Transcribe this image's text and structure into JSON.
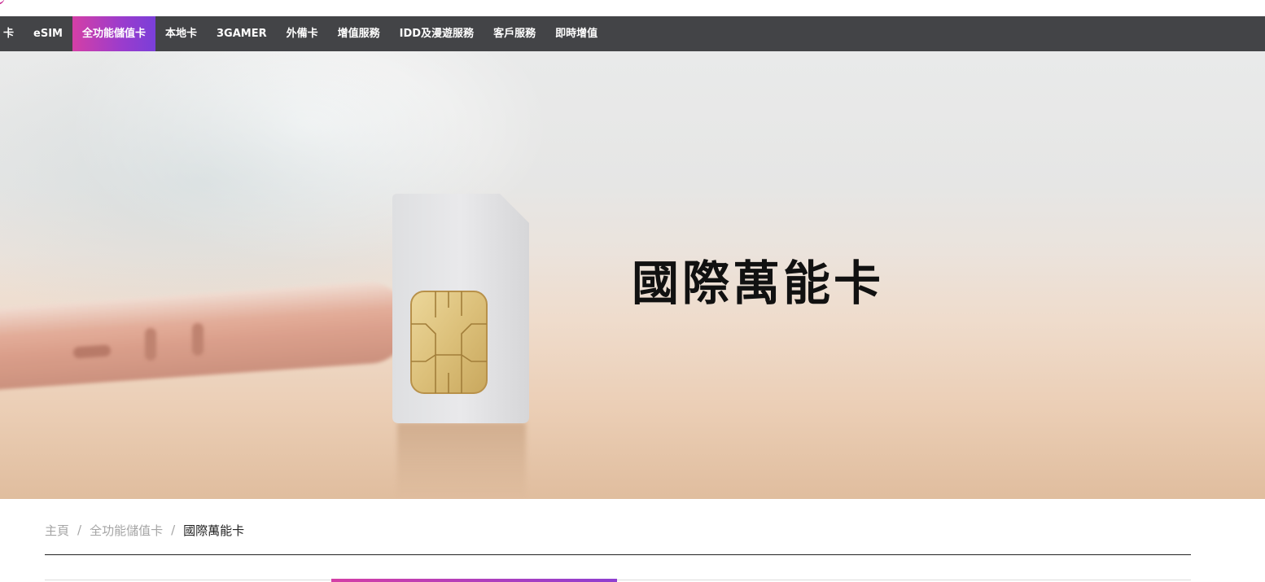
{
  "nav": {
    "items": [
      {
        "label": "卡",
        "active": false
      },
      {
        "label": "eSIM",
        "active": false
      },
      {
        "label": "全功能儲值卡",
        "active": true
      },
      {
        "label": "本地卡",
        "active": false
      },
      {
        "label": "3GAMER",
        "active": false
      },
      {
        "label": "外備卡",
        "active": false
      },
      {
        "label": "增值服務",
        "active": false
      },
      {
        "label": "IDD及漫遊服務",
        "active": false
      },
      {
        "label": "客戶服務",
        "active": false
      },
      {
        "label": "即時增值",
        "active": false
      }
    ]
  },
  "hero": {
    "title": "國際萬能卡"
  },
  "breadcrumb": {
    "home": "主頁",
    "separator": "/",
    "category": "全功能儲值卡",
    "current": "國際萬能卡"
  },
  "colors": {
    "nav_background": "#434447",
    "accent_start": "#d43fa6",
    "accent_end": "#7a3fd8"
  },
  "icons": {
    "logo": "logo-arc-icon",
    "hero_image": "sim-card-illustration"
  }
}
